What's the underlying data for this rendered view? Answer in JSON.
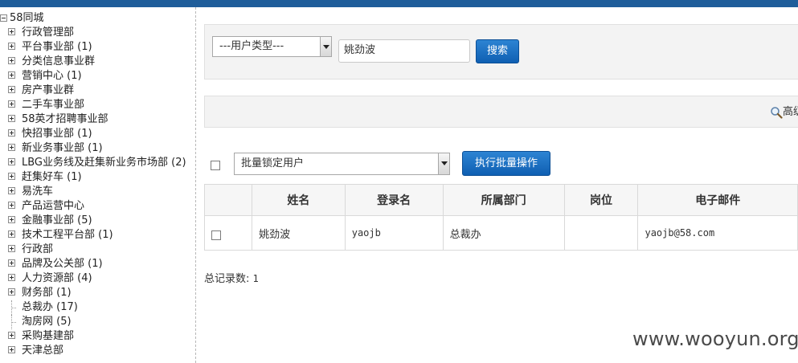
{
  "tree": {
    "root": "58同城",
    "items": [
      {
        "label": "行政管理部",
        "expandable": true
      },
      {
        "label": "平台事业部 (1)",
        "expandable": true
      },
      {
        "label": "分类信息事业群",
        "expandable": true
      },
      {
        "label": "营销中心 (1)",
        "expandable": true
      },
      {
        "label": "房产事业群",
        "expandable": true
      },
      {
        "label": "二手车事业部",
        "expandable": true
      },
      {
        "label": "58英才招聘事业部",
        "expandable": true
      },
      {
        "label": "快招事业部 (1)",
        "expandable": true
      },
      {
        "label": "新业务事业部 (1)",
        "expandable": true
      },
      {
        "label": "LBG业务线及赶集新业务市场部 (2)",
        "expandable": true
      },
      {
        "label": "赶集好车 (1)",
        "expandable": true
      },
      {
        "label": "易洗车",
        "expandable": true
      },
      {
        "label": "产品运营中心",
        "expandable": true
      },
      {
        "label": "金融事业部 (5)",
        "expandable": true
      },
      {
        "label": "技术工程平台部 (1)",
        "expandable": true
      },
      {
        "label": "行政部",
        "expandable": true
      },
      {
        "label": "品牌及公关部 (1)",
        "expandable": true
      },
      {
        "label": "人力资源部 (4)",
        "expandable": true
      },
      {
        "label": "财务部 (1)",
        "expandable": true
      },
      {
        "label": "总裁办 (17)",
        "expandable": false
      },
      {
        "label": "淘房网 (5)",
        "expandable": false
      },
      {
        "label": "采购基建部",
        "expandable": true
      },
      {
        "label": "天津总部",
        "expandable": true
      }
    ]
  },
  "search": {
    "user_type_select": "---用户类型---",
    "keyword_value": "姚劲波",
    "search_button": "搜索"
  },
  "advanced": {
    "link_label": "高级"
  },
  "batch": {
    "select_value": "批量锁定用户",
    "execute_button": "执行批量操作"
  },
  "table": {
    "headers": [
      "姓名",
      "登录名",
      "所属部门",
      "岗位",
      "电子邮件"
    ],
    "rows": [
      {
        "name": "姚劲波",
        "login": "yaojb",
        "department": "总裁办",
        "position": "",
        "email": "yaojb@58.com"
      }
    ]
  },
  "footer": {
    "total_label": "总记录数:",
    "total_value": "1"
  },
  "watermark": "www.wooyun.org",
  "colors": {
    "topbar": "#1f5d9a",
    "button": "#1a6fc4",
    "panel": "#f3f3f3"
  }
}
